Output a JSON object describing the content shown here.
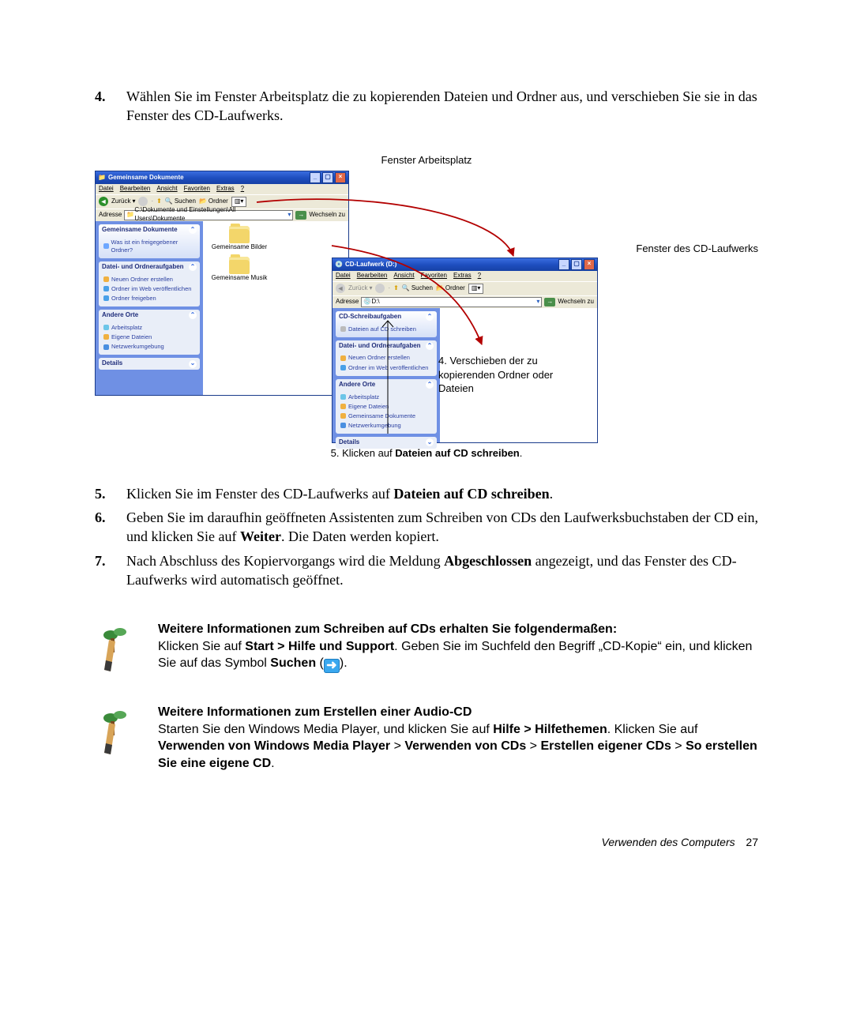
{
  "steps_a": [
    {
      "num": "4.",
      "text": "Wählen Sie im Fenster Arbeitsplatz die zu kopierenden Dateien und Ordner aus, und verschieben Sie sie in das Fenster des CD-Laufwerks."
    }
  ],
  "figure": {
    "caption_top": "Fenster Arbeitsplatz",
    "label_right_top": "Fenster des CD-Laufwerks",
    "annotation_right": "4. Verschieben der zu kopierenden Ordner oder Dateien",
    "caption_bottom_prefix": "5. Klicken auf ",
    "caption_bottom_bold": "Dateien auf CD schreiben",
    "caption_bottom_suffix": "."
  },
  "win1": {
    "title": "Gemeinsame Dokumente",
    "menu": [
      "Datei",
      "Bearbeiten",
      "Ansicht",
      "Favoriten",
      "Extras",
      "?"
    ],
    "back": "Zurück",
    "search": "Suchen",
    "folders": "Ordner",
    "addr_label": "Adresse",
    "addr_value": "C:\\Dokumente und Einstellungen\\All Users\\Dokumente",
    "go_label": "Wechseln zu",
    "side": {
      "block1_title": "Gemeinsame Dokumente",
      "block1_links": [
        "Was ist ein freigegebener Ordner?"
      ],
      "block2_title": "Datei- und Ordneraufgaben",
      "block2_links": [
        "Neuen Ordner erstellen",
        "Ordner im Web veröffentlichen",
        "Ordner freigeben"
      ],
      "block3_title": "Andere Orte",
      "block3_links": [
        "Arbeitsplatz",
        "Eigene Dateien",
        "Netzwerkumgebung"
      ],
      "block4_title": "Details"
    },
    "items": [
      "Gemeinsame Bilder",
      "Gemeinsame Musik"
    ]
  },
  "win2": {
    "title": "CD-Laufwerk (D:)",
    "menu": [
      "Datei",
      "Bearbeiten",
      "Ansicht",
      "Favoriten",
      "Extras",
      "?"
    ],
    "back": "Zurück",
    "search": "Suchen",
    "folders": "Ordner",
    "addr_label": "Adresse",
    "addr_value": "D:\\",
    "go_label": "Wechseln zu",
    "side": {
      "block1_title": "CD-Schreibaufgaben",
      "block1_links": [
        "Dateien auf CD schreiben"
      ],
      "block2_title": "Datei- und Ordneraufgaben",
      "block2_links": [
        "Neuen Ordner erstellen",
        "Ordner im Web veröffentlichen"
      ],
      "block3_title": "Andere Orte",
      "block3_links": [
        "Arbeitsplatz",
        "Eigene Dateien",
        "Gemeinsame Dokumente",
        "Netzwerkumgebung"
      ],
      "block4_title": "Details"
    }
  },
  "steps_b": [
    {
      "num": "5.",
      "html": [
        {
          "t": "Klicken Sie im Fenster des CD-Laufwerks auf "
        },
        {
          "b": "Dateien auf CD schreiben"
        },
        {
          "t": "."
        }
      ]
    },
    {
      "num": "6.",
      "html": [
        {
          "t": "Geben Sie im daraufhin geöffneten Assistenten zum Schreiben von CDs den Laufwerksbuchstaben der CD ein, und klicken Sie auf "
        },
        {
          "b": "Weiter"
        },
        {
          "t": ". Die Daten werden kopiert."
        }
      ]
    },
    {
      "num": "7.",
      "html": [
        {
          "t": "Nach Abschluss des Kopiervorgangs wird die Meldung "
        },
        {
          "b": "Abgeschlossen"
        },
        {
          "t": " angezeigt, und das Fenster des CD-Laufwerks wird automatisch geöffnet."
        }
      ]
    }
  ],
  "tips": [
    {
      "heading": "Weitere Informationen zum Schreiben auf CDs erhalten Sie folgendermaßen:",
      "body": [
        {
          "t": "Klicken Sie auf "
        },
        {
          "b": "Start > Hilfe und Support"
        },
        {
          "t": ". Geben Sie im Suchfeld den Begriff „CD-Kopie“ ein, und klicken Sie auf das Symbol "
        },
        {
          "b": "Suchen"
        },
        {
          "t": " ("
        },
        {
          "icon": true
        },
        {
          "t": ")."
        }
      ]
    },
    {
      "heading": "Weitere Informationen zum Erstellen einer Audio-CD",
      "body": [
        {
          "t": "Starten Sie den Windows Media Player, und klicken Sie auf "
        },
        {
          "b": "Hilfe > Hilfethemen"
        },
        {
          "t": ". Klicken Sie auf "
        },
        {
          "b": "Verwenden von Windows Media Player"
        },
        {
          "t": " > "
        },
        {
          "b": "Verwenden von CDs"
        },
        {
          "t": " > "
        },
        {
          "b": "Erstellen eigener CDs"
        },
        {
          "t": " > "
        },
        {
          "b": "So erstellen Sie eine eigene CD"
        },
        {
          "t": "."
        }
      ]
    }
  ],
  "footer": {
    "section": "Verwenden des Computers",
    "page": "27"
  }
}
